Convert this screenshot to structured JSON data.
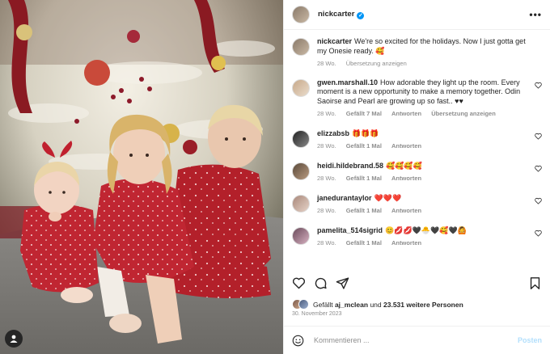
{
  "header": {
    "username": "nickcarter",
    "verified_icon": "verified-badge-icon",
    "more_icon": "more-options-icon"
  },
  "caption": {
    "username": "nickcarter",
    "text": "We're so excited for the holidays. Now I just gotta get my Onesie ready. 🥰",
    "age": "28 Wo.",
    "translate": "Übersetzung anzeigen"
  },
  "comments": [
    {
      "username": "gwen.marshall.10",
      "text": "How adorable they light up the room. Every moment is a new opportunity to make a memory together. Odin Saoirse and Pearl are growing up so fast.. ♥♥",
      "age": "28 Wo.",
      "likes": "Gefällt 7 Mal",
      "reply": "Antworten",
      "translate": "Übersetzung anzeigen"
    },
    {
      "username": "elizzabsb",
      "text": "🎁🎁🎁",
      "age": "28 Wo.",
      "likes": "Gefällt 1 Mal",
      "reply": "Antworten"
    },
    {
      "username": "heidi.hildebrand.58",
      "text": "🥰🥰🥰🥰",
      "age": "28 Wo.",
      "likes": "Gefällt 1 Mal",
      "reply": "Antworten"
    },
    {
      "username": "janedurantaylor",
      "text": "❤️❤️❤️",
      "age": "28 Wo.",
      "likes": "Gefällt 1 Mal",
      "reply": "Antworten"
    },
    {
      "username": "pamelita_514sigrid",
      "text": "😊💋💋🖤🐣🖤🥰🖤🙆",
      "age": "28 Wo.",
      "likes": "Gefällt 1 Mal",
      "reply": "Antworten"
    }
  ],
  "actions": {
    "like_icon": "heart-icon",
    "comment_icon": "comment-icon",
    "share_icon": "share-icon",
    "save_icon": "bookmark-icon"
  },
  "likes": {
    "prefix": "Gefällt",
    "user": "aj_mclean",
    "connector": "und",
    "count": "23.531 weitere Personen"
  },
  "date": "30. November 2023",
  "add_comment": {
    "placeholder": "Kommentieren ...",
    "post_label": "Posten"
  },
  "colors": {
    "accent": "#0095f6",
    "muted": "#8e8e8e",
    "text": "#262626",
    "post_disabled": "#b2dffc",
    "pajama_red": "#b3202a"
  }
}
